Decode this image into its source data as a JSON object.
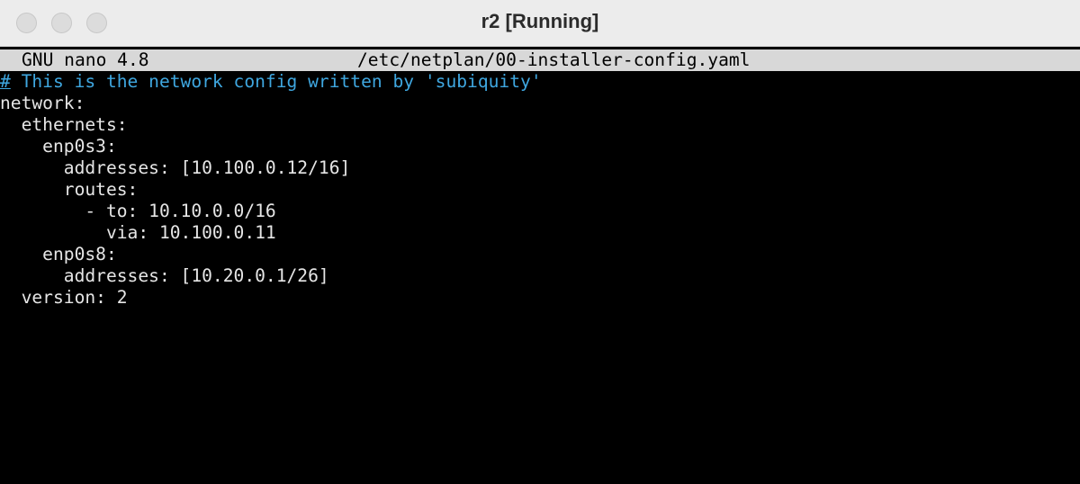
{
  "window": {
    "title": "r2 [Running]"
  },
  "nano": {
    "version": "GNU nano 4.8",
    "filename": "/etc/netplan/00-installer-config.yaml"
  },
  "file_lines": [
    {
      "text": "# This is the network config written by 'subiquity'",
      "type": "comment"
    },
    {
      "text": "network:",
      "type": "code"
    },
    {
      "text": "  ethernets:",
      "type": "code"
    },
    {
      "text": "    enp0s3:",
      "type": "code"
    },
    {
      "text": "      addresses: [10.100.0.12/16]",
      "type": "code"
    },
    {
      "text": "      routes:",
      "type": "code"
    },
    {
      "text": "        - to: 10.10.0.0/16",
      "type": "code"
    },
    {
      "text": "          via: 10.100.0.11",
      "type": "code"
    },
    {
      "text": "    enp0s8:",
      "type": "code"
    },
    {
      "text": "      addresses: [10.20.0.1/26]",
      "type": "code"
    },
    {
      "text": "  version: 2",
      "type": "code"
    }
  ],
  "colors": {
    "comment": "#3fa7e0",
    "text": "#e6e6e6",
    "header_bg": "#d8d8d8",
    "terminal_bg": "#000000"
  }
}
